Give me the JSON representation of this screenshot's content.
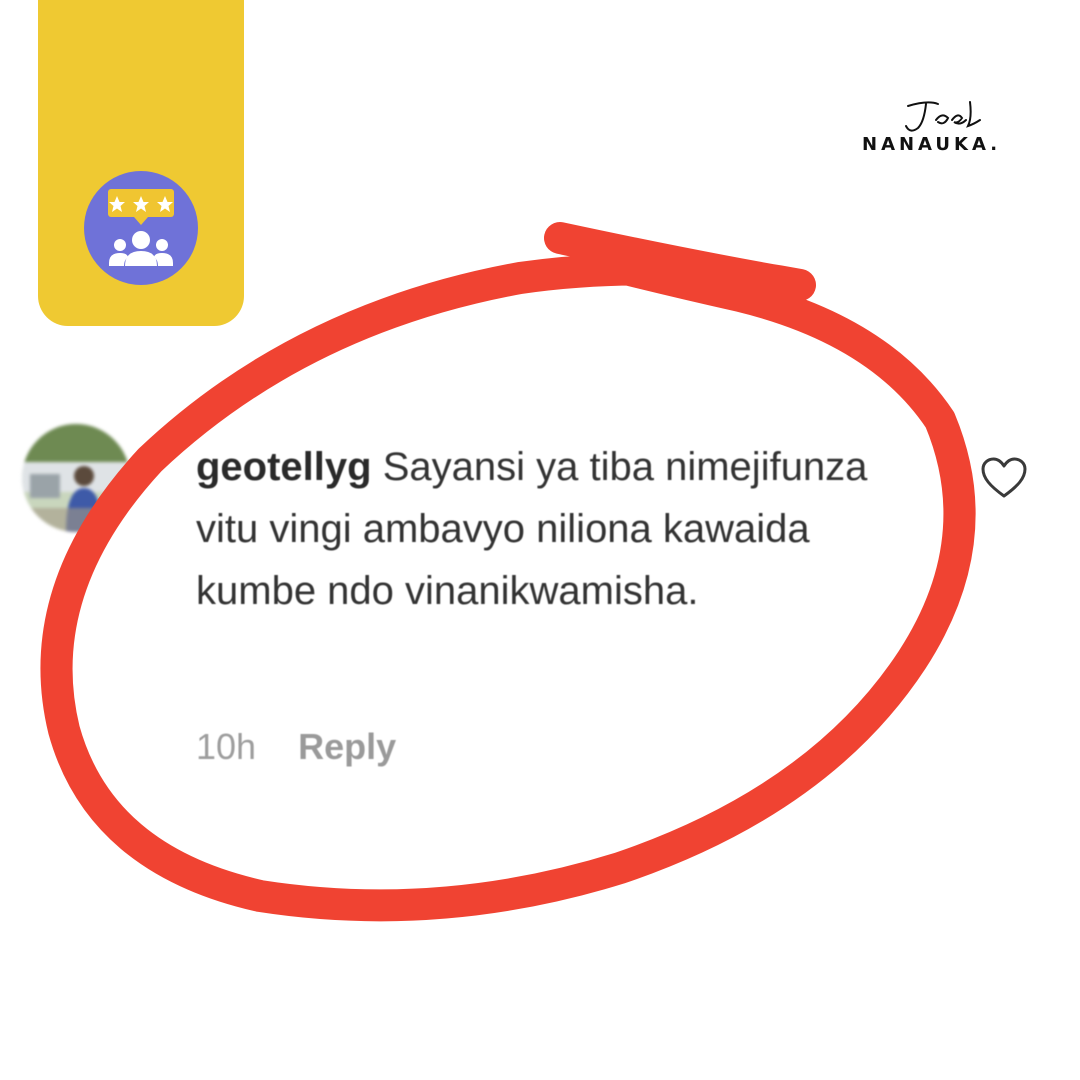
{
  "branding": {
    "logo_text": "NANAUKA.",
    "logo_signature_text": "Joel",
    "badge_icon": "reviews-icon"
  },
  "comment": {
    "username": "geotellyg",
    "text": "Sayansi ya tiba nimejifunza vitu vingi ambavyo niliona kawaida kumbe ndo vinanikwamisha.",
    "time": "10h",
    "reply_label": "Reply",
    "like_icon": "heart-icon",
    "avatar_icon": "profile-photo"
  },
  "colors": {
    "yellow": "#efc932",
    "badge": "#6f72d8",
    "annotation": "#f04332"
  }
}
